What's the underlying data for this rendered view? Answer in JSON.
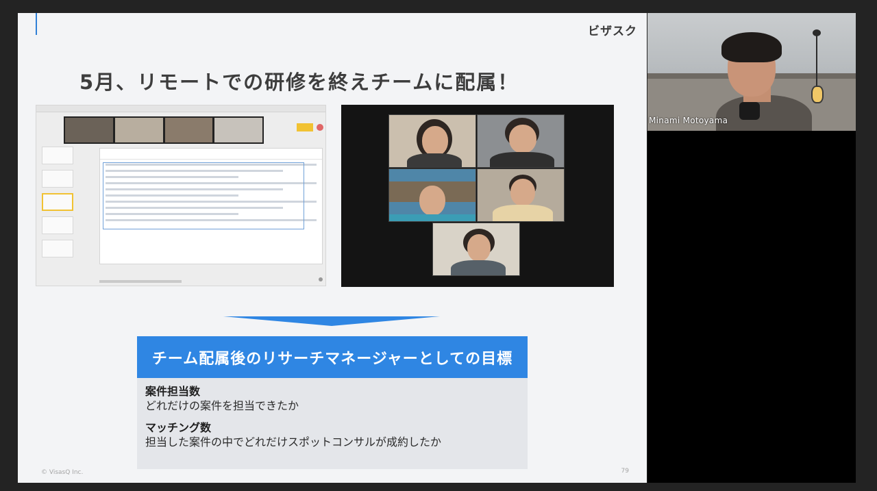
{
  "slide": {
    "brand": "ビザスク",
    "title": "5月、リモートでの研修を終えチームに配属！",
    "goal": {
      "header": "チーム配属後のリサーチマネージャーとしての目標",
      "items": [
        {
          "title": "案件担当数",
          "desc": "どれだけの案件を担当できたか"
        },
        {
          "title": "マッチング数",
          "desc": "担当した案件の中でどれだけスポットコンサルが成約したか"
        }
      ]
    },
    "copyright": "© VisasQ Inc.",
    "page_number": "79"
  },
  "speaker": {
    "name": "Minami Motoyama"
  },
  "colors": {
    "accent": "#2f86e3",
    "background": "#232323",
    "slide_bg": "#f3f4f6"
  }
}
